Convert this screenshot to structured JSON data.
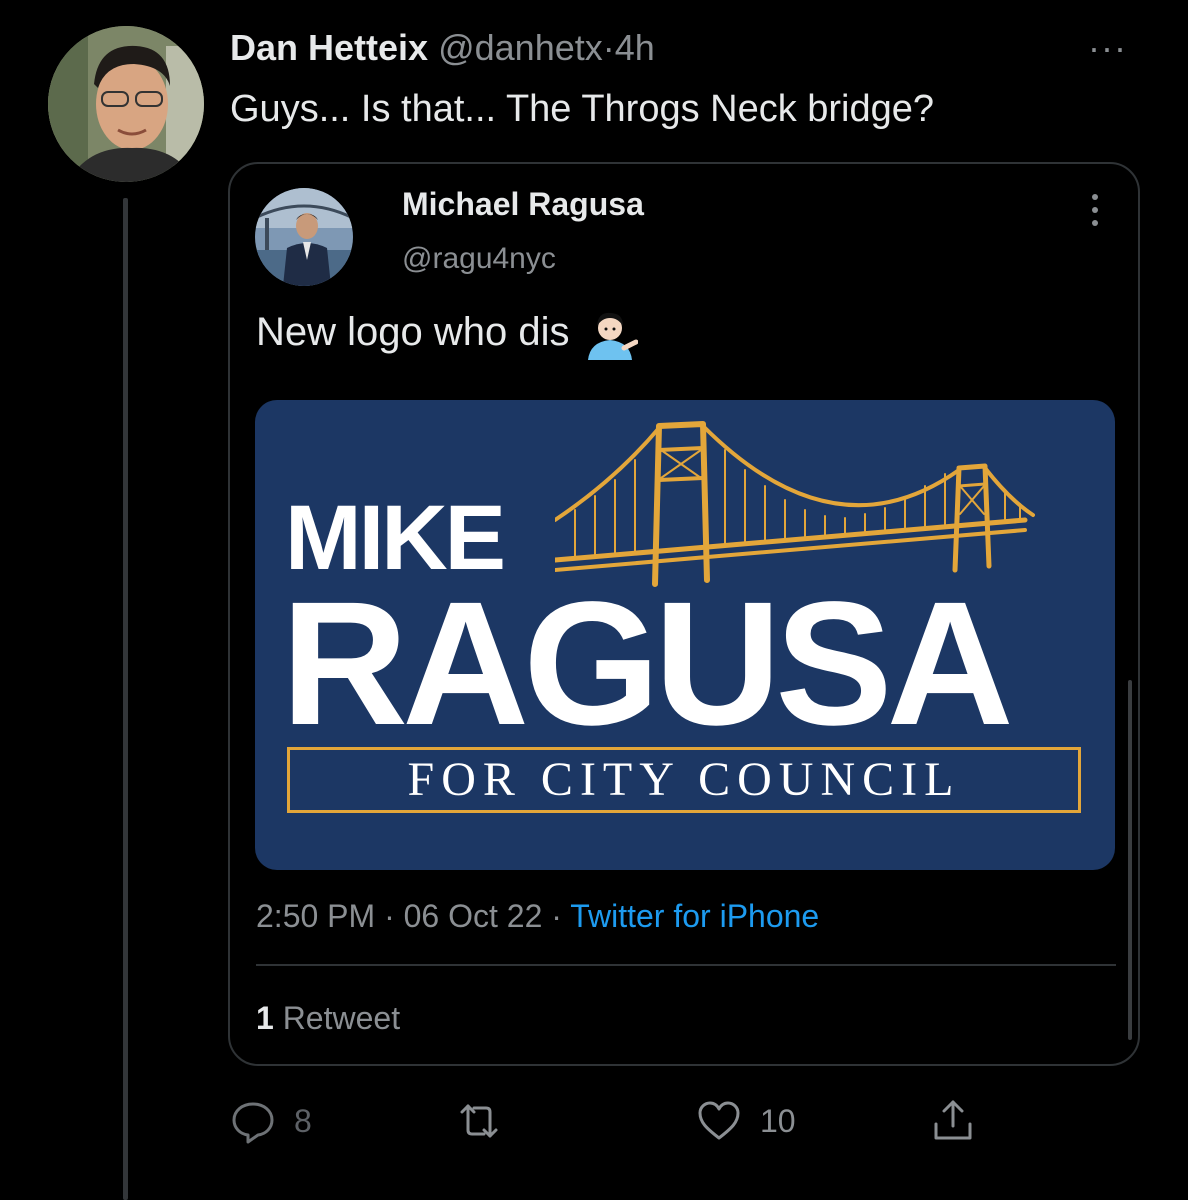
{
  "tweet": {
    "author_name": "Dan Hetteix",
    "author_handle": "@danhetx",
    "separator": "·",
    "time": "4h",
    "more_label": "···",
    "text": "Guys... Is that... The Throgs Neck bridge?"
  },
  "quoted_tweet": {
    "author_name": "Michael Ragusa",
    "author_handle": "@ragu4nyc",
    "text": "New logo who dis",
    "emoji_icon": "person-tipping-hand-icon",
    "logo_image": {
      "line1": "MIKE",
      "line2": "RAGUSA",
      "line3": "FOR CITY COUNCIL",
      "background_color": "#1c3764",
      "accent_color": "#e3a63a",
      "icon": "bridge-icon"
    },
    "meta": {
      "time": "2:50 PM",
      "separator": "·",
      "date": "06 Oct 22",
      "source": "Twitter for iPhone"
    },
    "retweets": {
      "count": "1",
      "label": "Retweet"
    }
  },
  "actions": {
    "reply_count": "8",
    "like_count": "10"
  },
  "colors": {
    "background": "#000000",
    "text_primary": "#e7e9ea",
    "text_secondary": "#8b8f93",
    "link": "#1d9bf0",
    "border": "#2f3336"
  }
}
